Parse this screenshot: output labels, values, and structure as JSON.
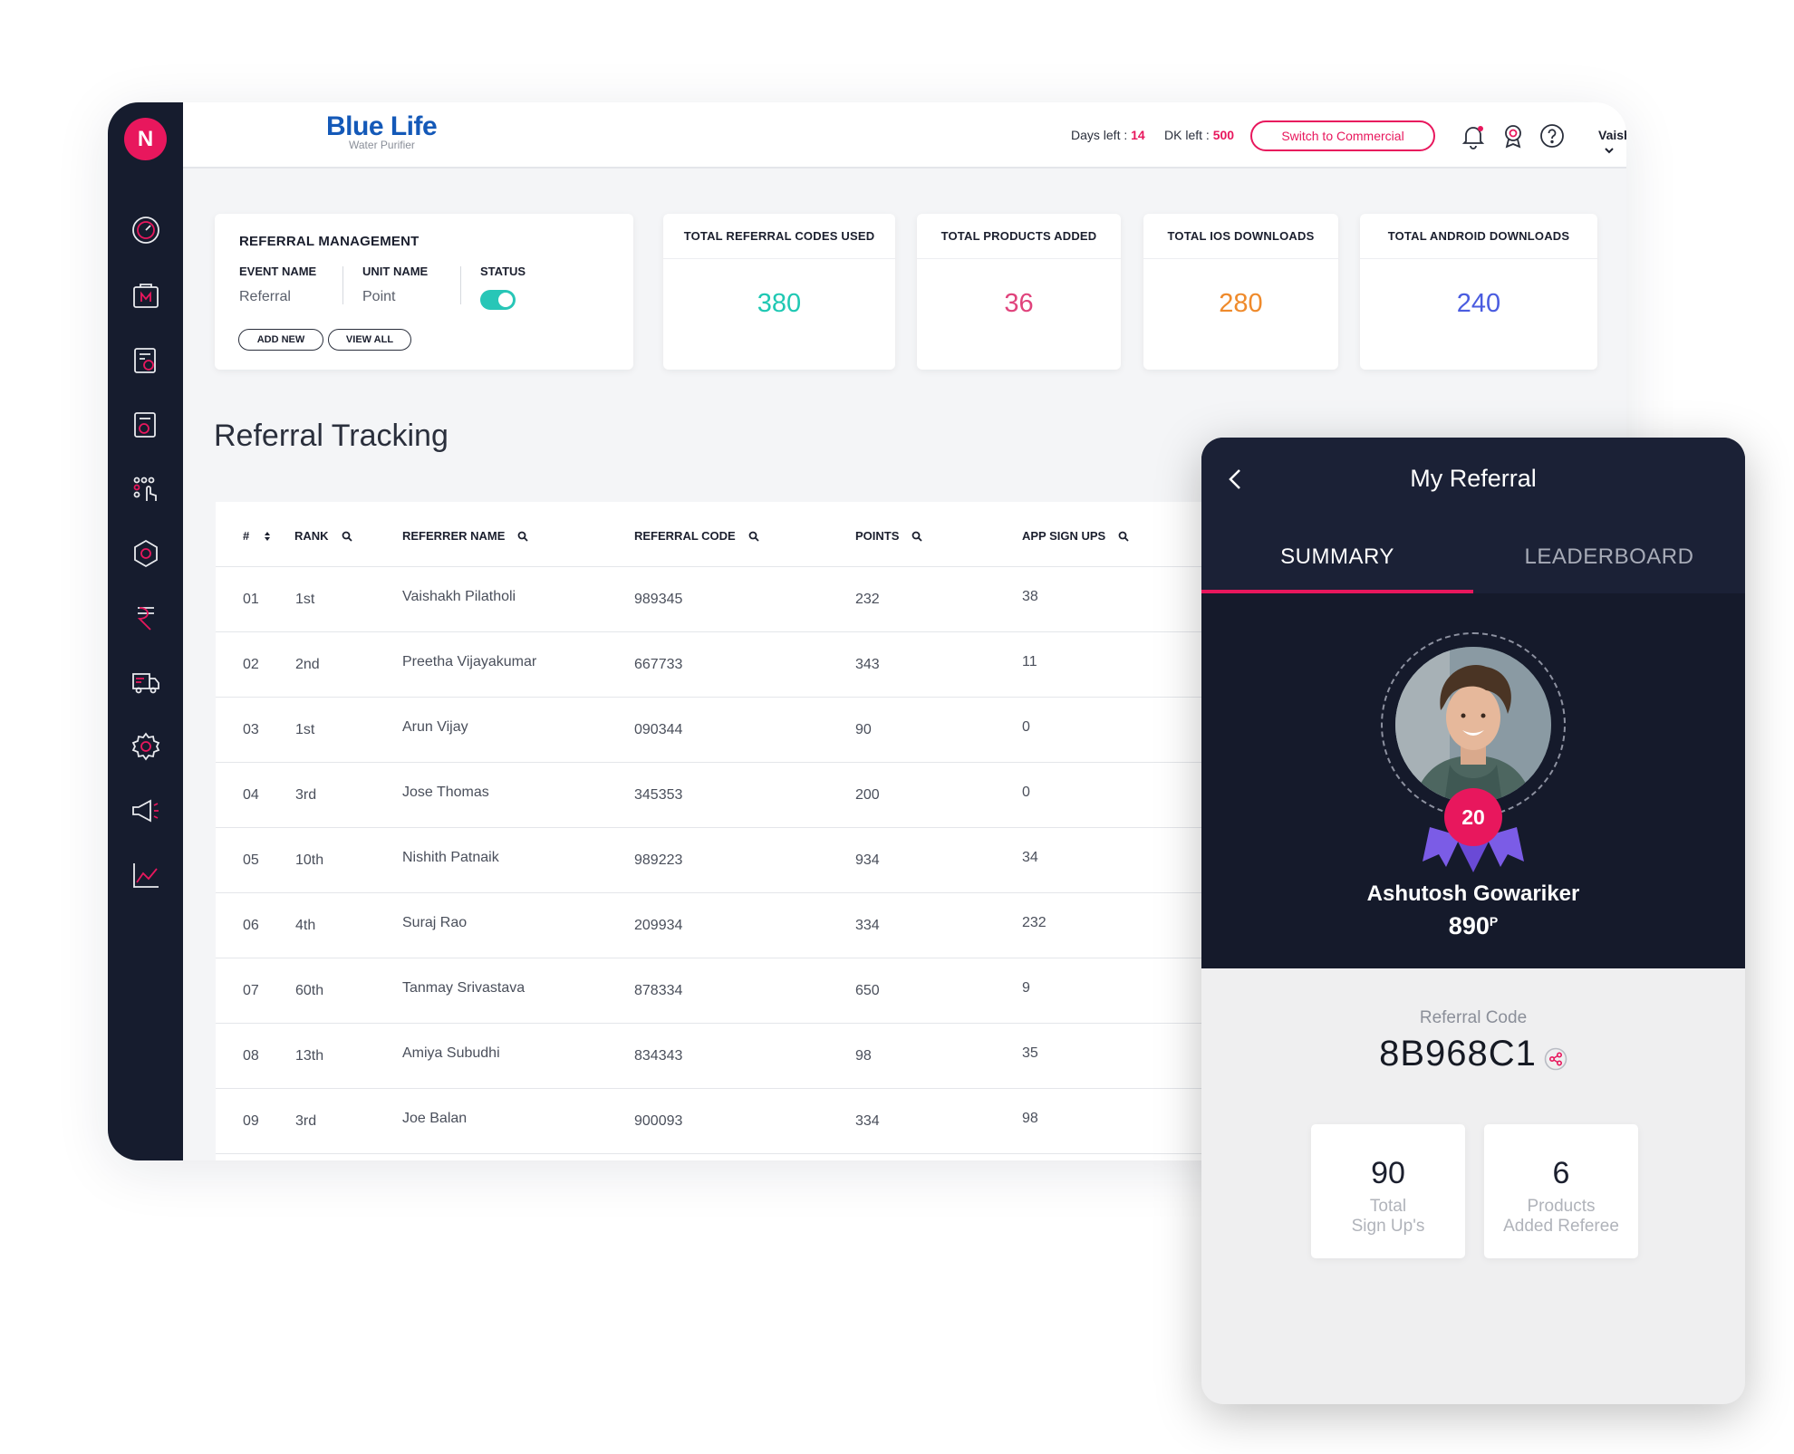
{
  "brand": {
    "name": "Blue Life",
    "tagline": "Water Purifier",
    "logo_letter": "N"
  },
  "topbar": {
    "days_left_label": "Days left :",
    "days_left_value": "14",
    "dk_left_label": "DK left :",
    "dk_left_value": "500",
    "switch_label": "Switch to Commercial",
    "user_name": "Vaishakh"
  },
  "sidebar_icons": [
    "dashboard-icon",
    "logo-box-icon",
    "settings-doc-icon",
    "clipboard-icon",
    "touch-grid-icon",
    "network-icon",
    "rupee-icon",
    "truck-icon",
    "gear-icon",
    "megaphone-icon",
    "analytics-icon"
  ],
  "referral_management": {
    "title": "REFERRAL MANAGEMENT",
    "event_name_label": "EVENT NAME",
    "event_name_value": "Referral",
    "unit_name_label": "UNIT NAME",
    "unit_name_value": "Point",
    "status_label": "STATUS",
    "add_new": "ADD NEW",
    "view_all": "VIEW ALL"
  },
  "stats": [
    {
      "title": "TOTAL REFERRAL CODES USED",
      "value": "380",
      "color": "#1fc8b3"
    },
    {
      "title": "TOTAL PRODUCTS ADDED",
      "value": "36",
      "color": "#e0437c"
    },
    {
      "title": "TOTAL IOS DOWNLOADS",
      "value": "280",
      "color": "#ef8a2b"
    },
    {
      "title": "TOTAL ANDROID DOWNLOADS",
      "value": "240",
      "color": "#4a5ce0"
    }
  ],
  "section_title": "Referral Tracking",
  "table": {
    "headers": [
      "#",
      "RANK",
      "REFERRER NAME",
      "REFERRAL CODE",
      "POINTS",
      "APP SIGN UPS"
    ],
    "rows": [
      [
        "01",
        "1st",
        "Vaishakh Pilatholi",
        "989345",
        "232",
        "38"
      ],
      [
        "02",
        "2nd",
        "Preetha Vijayakumar",
        "667733",
        "343",
        "11"
      ],
      [
        "03",
        "1st",
        "Arun Vijay",
        "090344",
        "90",
        "0"
      ],
      [
        "04",
        "3rd",
        "Jose Thomas",
        "345353",
        "200",
        "0"
      ],
      [
        "05",
        "10th",
        "Nishith Patnaik",
        "989223",
        "934",
        "34"
      ],
      [
        "06",
        "4th",
        "Suraj Rao",
        "209934",
        "334",
        "232"
      ],
      [
        "07",
        "60th",
        "Tanmay Srivastava",
        "878334",
        "650",
        "9"
      ],
      [
        "08",
        "13th",
        "Amiya Subudhi",
        "834343",
        "98",
        "35"
      ],
      [
        "09",
        "3rd",
        "Joe Balan",
        "900093",
        "334",
        "98"
      ]
    ]
  },
  "phone": {
    "title": "My Referral",
    "tabs": [
      "SUMMARY",
      "LEADERBOARD"
    ],
    "badge": "20",
    "name": "Ashutosh Gowariker",
    "points": "890",
    "points_unit": "P",
    "referral_code_label": "Referral Code",
    "referral_code": "8B968C1",
    "stats": [
      {
        "value": "90",
        "label_line1": "Total",
        "label_line2": "Sign Up's"
      },
      {
        "value": "6",
        "label_line1": "Products",
        "label_line2": "Added Referee"
      }
    ]
  },
  "colors": {
    "accent": "#e8175d",
    "sidebar": "#161c2e",
    "brand_blue": "#1459b8",
    "toggle": "#28c6b7"
  }
}
